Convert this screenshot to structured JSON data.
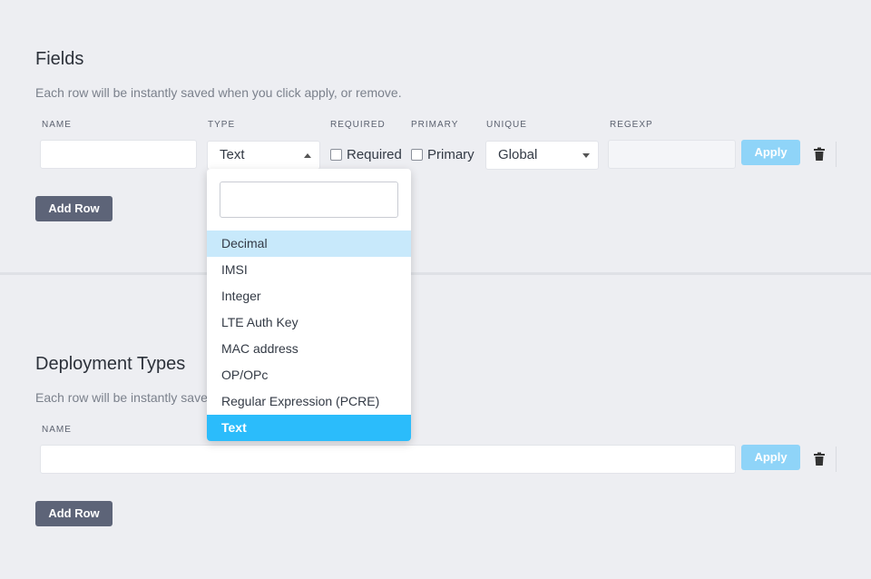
{
  "fields": {
    "title": "Fields",
    "description": "Each row will be instantly saved when you click apply, or remove.",
    "columns": {
      "name": "NAME",
      "type": "TYPE",
      "required": "REQUIRED",
      "primary": "PRIMARY",
      "unique": "UNIQUE",
      "regexp": "REGEXP"
    },
    "row": {
      "name_value": "",
      "type_value": "Text",
      "required_label": "Required",
      "primary_label": "Primary",
      "unique_value": "Global",
      "regexp_value": "",
      "apply_label": "Apply"
    },
    "add_row_label": "Add Row"
  },
  "type_dropdown": {
    "search_value": "",
    "options": [
      "Decimal",
      "IMSI",
      "Integer",
      "LTE Auth Key",
      "MAC address",
      "OP/OPc",
      "Regular Expression (PCRE)",
      "Text"
    ],
    "hovered": "Decimal",
    "selected": "Text"
  },
  "deployment_types": {
    "title": "Deployment Types",
    "description": "Each row will be instantly saved when you click apply, or remove.",
    "columns": {
      "name": "NAME"
    },
    "row": {
      "name_value": "",
      "apply_label": "Apply"
    },
    "add_row_label": "Add Row"
  },
  "colors": {
    "background": "#edeef2",
    "apply_button": "#8fd4f8",
    "add_row_button": "#5d6478",
    "dropdown_selected": "#2bbcfb",
    "dropdown_hover": "#c8e9fb"
  }
}
